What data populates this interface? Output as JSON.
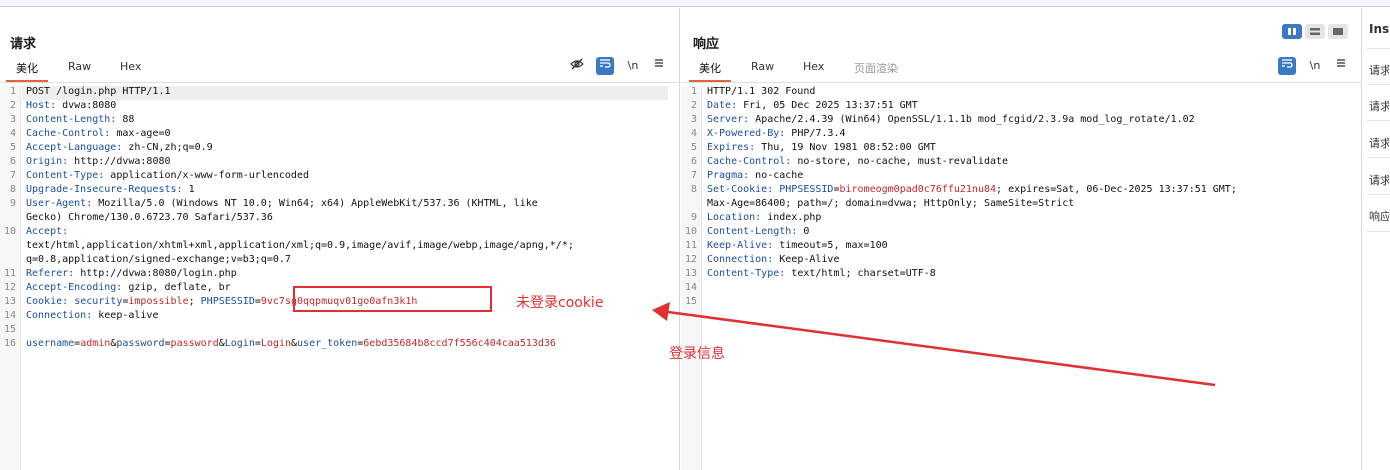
{
  "request": {
    "title": "请求",
    "tabs": [
      "美化",
      "Raw",
      "Hex"
    ],
    "active_tab": "美化",
    "tools": [
      "eye-off-icon",
      "wrap-icon",
      "\\n",
      "menu-icon"
    ],
    "lines": [
      {
        "n": "1",
        "text": "POST /login.php HTTP/1.1"
      },
      {
        "n": "2",
        "name": "Host",
        "value": "dvwa:8080"
      },
      {
        "n": "3",
        "name": "Content-Length",
        "value": "88"
      },
      {
        "n": "4",
        "name": "Cache-Control",
        "value": "max-age=0"
      },
      {
        "n": "5",
        "name": "Accept-Language",
        "value": "zh-CN,zh;q=0.9"
      },
      {
        "n": "6",
        "name": "Origin",
        "value": "http://dvwa:8080"
      },
      {
        "n": "7",
        "name": "Content-Type",
        "value": "application/x-www-form-urlencoded"
      },
      {
        "n": "8",
        "name": "Upgrade-Insecure-Requests",
        "value": "1"
      },
      {
        "n": "9",
        "name": "User-Agent",
        "value": "Mozilla/5.0 (Windows NT 10.0; Win64; x64) AppleWebKit/537.36 (KHTML, like"
      },
      {
        "n": "",
        "text": "Gecko) Chrome/130.0.6723.70 Safari/537.36"
      },
      {
        "n": "10",
        "name": "Accept",
        "value": ""
      },
      {
        "n": "",
        "text": "text/html,application/xhtml+xml,application/xml;q=0.9,image/avif,image/webp,image/apng,*/*;"
      },
      {
        "n": "",
        "text": "q=0.8,application/signed-exchange;v=b3;q=0.7"
      },
      {
        "n": "11",
        "name": "Referer",
        "value": "http://dvwa:8080/login.php"
      },
      {
        "n": "12",
        "name": "Accept-Encoding",
        "value": "gzip, deflate, br"
      },
      {
        "n": "13",
        "name": "Cookie",
        "cookie": [
          [
            "security",
            "impossible"
          ],
          [
            "PHPSESSID",
            "9vc7sg0qqpmuqv01go0afn3k1h"
          ]
        ]
      },
      {
        "n": "14",
        "name": "Connection",
        "value": "keep-alive"
      },
      {
        "n": "15",
        "text": ""
      },
      {
        "n": "16",
        "params": [
          [
            "username",
            "admin"
          ],
          [
            "password",
            "password"
          ],
          [
            "Login",
            "Login"
          ],
          [
            "user_token",
            "6ebd35684b8ccd7f556c404caa513d36"
          ]
        ]
      }
    ]
  },
  "response": {
    "title": "响应",
    "tabs": [
      "美化",
      "Raw",
      "Hex",
      "页面渲染"
    ],
    "active_tab": "美化",
    "tools": [
      "wrap-icon",
      "\\n",
      "menu-icon"
    ],
    "lines": [
      {
        "n": "1",
        "text": "HTTP/1.1 302 Found"
      },
      {
        "n": "2",
        "name": "Date",
        "value": "Fri, 05 Dec 2025 13:37:51 GMT"
      },
      {
        "n": "3",
        "name": "Server",
        "value": "Apache/2.4.39 (Win64) OpenSSL/1.1.1b mod_fcgid/2.3.9a mod_log_rotate/1.02"
      },
      {
        "n": "4",
        "name": "X-Powered-By",
        "value": "PHP/7.3.4"
      },
      {
        "n": "5",
        "name": "Expires",
        "value": "Thu, 19 Nov 1981 08:52:00 GMT"
      },
      {
        "n": "6",
        "name": "Cache-Control",
        "value": "no-store, no-cache, must-revalidate"
      },
      {
        "n": "7",
        "name": "Pragma",
        "value": "no-cache"
      },
      {
        "n": "8",
        "name": "Set-Cookie",
        "setcookie": [
          "PHPSESSID",
          "biromeogm0pad0c76ffu21nu84",
          "; expires=Sat, 06-Dec-2025 13:37:51 GMT;"
        ]
      },
      {
        "n": "",
        "text": "Max-Age=86400; path=/; domain=dvwa; HttpOnly; SameSite=Strict"
      },
      {
        "n": "9",
        "name": "Location",
        "value": "index.php"
      },
      {
        "n": "10",
        "name": "Content-Length",
        "value": "0"
      },
      {
        "n": "11",
        "name": "Keep-Alive",
        "value": "timeout=5, max=100"
      },
      {
        "n": "12",
        "name": "Connection",
        "value": "Keep-Alive"
      },
      {
        "n": "13",
        "name": "Content-Type",
        "value": "text/html; charset=UTF-8"
      },
      {
        "n": "14",
        "text": ""
      },
      {
        "n": "15",
        "text": ""
      }
    ]
  },
  "inspector": {
    "title": "Ins",
    "items": [
      "请求",
      "请求",
      "请求",
      "请求",
      "响应"
    ]
  },
  "annotations": {
    "cookie_label": "未登录cookie",
    "login_label": "登录信息"
  },
  "colors": {
    "header_name": "#1b4fa0",
    "value_highlight": "#c0282b",
    "active_tab": "#e0653a",
    "annotation": "#e03030",
    "accent_blue": "#3b79c4"
  }
}
